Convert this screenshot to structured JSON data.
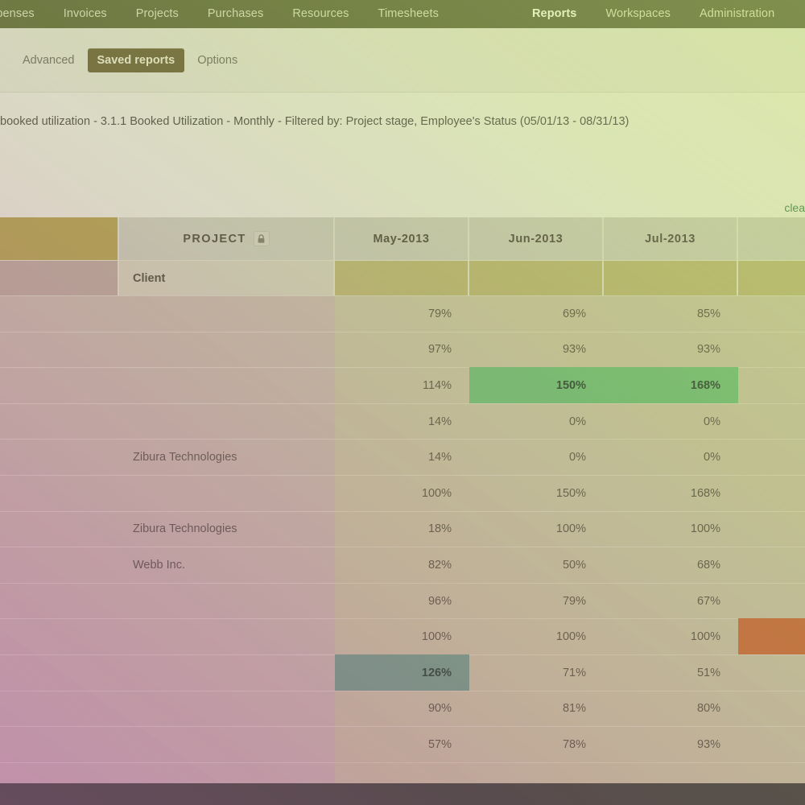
{
  "topnav": {
    "left_items": [
      {
        "label": "xpenses",
        "active": false
      },
      {
        "label": "Invoices",
        "active": false
      },
      {
        "label": "Projects",
        "active": false
      },
      {
        "label": "Purchases",
        "active": false
      },
      {
        "label": "Resources",
        "active": false
      },
      {
        "label": "Timesheets",
        "active": false
      }
    ],
    "right_items": [
      {
        "label": "Reports",
        "active": true
      },
      {
        "label": "Workspaces",
        "active": false
      },
      {
        "label": "Administration",
        "active": false
      }
    ]
  },
  "subnav": {
    "items": [
      {
        "label": "Advanced",
        "active": false
      },
      {
        "label": "Saved reports",
        "active": true
      },
      {
        "label": "Options",
        "active": false
      }
    ]
  },
  "report": {
    "title": "booked utilization - 3.1.1 Booked Utilization - Monthly - Filtered by: Project stage, Employee's Status (05/01/13 - 08/31/13)",
    "clear_link": "clea"
  },
  "grid": {
    "header_top": {
      "rowhdr": "",
      "project": "PROJECT",
      "project_lock_icon": "lock-icon",
      "months": [
        "May-2013",
        "Jun-2013",
        "Jul-2013",
        ""
      ]
    },
    "header_sub": {
      "rowhdr": "",
      "client": "Client",
      "months": [
        "",
        "",
        "",
        ""
      ]
    },
    "rows": [
      {
        "rowhdr": "",
        "client": "",
        "values": [
          "79%",
          "69%",
          "85%",
          ""
        ],
        "highlights": [
          "none",
          "none",
          "none",
          "none"
        ]
      },
      {
        "rowhdr": "",
        "client": "",
        "values": [
          "97%",
          "93%",
          "93%",
          ""
        ],
        "highlights": [
          "none",
          "none",
          "none",
          "none"
        ]
      },
      {
        "rowhdr": "",
        "client": "",
        "values": [
          "114%",
          "150%",
          "168%",
          ""
        ],
        "highlights": [
          "none",
          "green",
          "green",
          "none"
        ]
      },
      {
        "rowhdr": "",
        "client": "",
        "values": [
          "14%",
          "0%",
          "0%",
          ""
        ],
        "highlights": [
          "none",
          "none",
          "none",
          "none"
        ]
      },
      {
        "rowhdr": "",
        "client": "Zibura Technologies",
        "values": [
          "14%",
          "0%",
          "0%",
          ""
        ],
        "highlights": [
          "none",
          "none",
          "none",
          "none"
        ]
      },
      {
        "rowhdr": "",
        "client": "",
        "values": [
          "100%",
          "150%",
          "168%",
          ""
        ],
        "highlights": [
          "none",
          "none",
          "none",
          "none"
        ]
      },
      {
        "rowhdr": "",
        "client": "Zibura Technologies",
        "values": [
          "18%",
          "100%",
          "100%",
          ""
        ],
        "highlights": [
          "none",
          "none",
          "none",
          "none"
        ]
      },
      {
        "rowhdr": "",
        "client": "Webb Inc.",
        "values": [
          "82%",
          "50%",
          "68%",
          ""
        ],
        "highlights": [
          "none",
          "none",
          "none",
          "none"
        ]
      },
      {
        "rowhdr": "",
        "client": "",
        "values": [
          "96%",
          "79%",
          "67%",
          ""
        ],
        "highlights": [
          "none",
          "none",
          "none",
          "none"
        ]
      },
      {
        "rowhdr": "",
        "client": "",
        "values": [
          "100%",
          "100%",
          "100%",
          ""
        ],
        "highlights": [
          "none",
          "none",
          "none",
          "orange"
        ]
      },
      {
        "rowhdr": "",
        "client": "",
        "values": [
          "126%",
          "71%",
          "51%",
          ""
        ],
        "highlights": [
          "teal",
          "none",
          "none",
          "none"
        ]
      },
      {
        "rowhdr": "",
        "client": "",
        "values": [
          "90%",
          "81%",
          "80%",
          ""
        ],
        "highlights": [
          "none",
          "none",
          "none",
          "none"
        ]
      },
      {
        "rowhdr": "",
        "client": "",
        "values": [
          "57%",
          "78%",
          "93%",
          ""
        ],
        "highlights": [
          "none",
          "none",
          "none",
          "none"
        ]
      },
      {
        "rowhdr": "",
        "client": "",
        "values": [
          "",
          "",
          "",
          ""
        ],
        "highlights": [
          "none",
          "none",
          "none",
          "none"
        ]
      }
    ]
  },
  "colors": {
    "nav_bg": "#5f6a33",
    "active_pill": "#6b6232",
    "highlight_green": "#6ec278",
    "highlight_teal": "#72a08c",
    "highlight_orange": "#cf6a2e",
    "header_gold": "#b6a34c",
    "footer": "#3b3b34"
  }
}
